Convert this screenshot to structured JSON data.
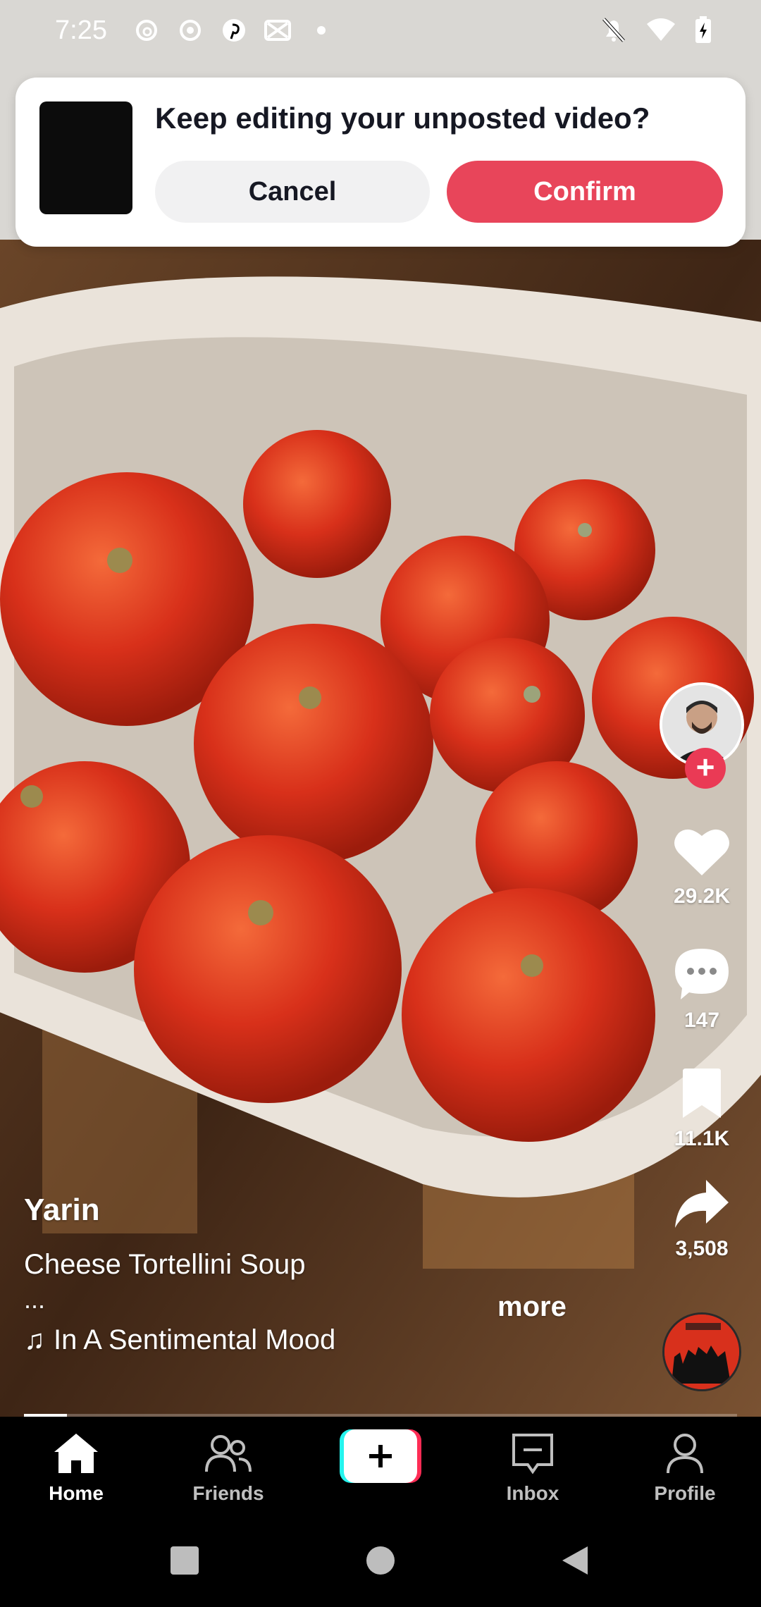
{
  "status_bar": {
    "time": "7:25",
    "left_icons": [
      "threads-icon",
      "record-icon",
      "pinterest-icon",
      "capcut-icon",
      "dot-icon"
    ],
    "right_icons": [
      "bell-off-icon",
      "wifi-icon",
      "battery-charging-icon"
    ]
  },
  "draft_banner": {
    "title": "Keep editing your unposted video?",
    "cancel_label": "Cancel",
    "confirm_label": "Confirm"
  },
  "rail": {
    "likes": "29.2K",
    "comments": "147",
    "bookmarks": "11.1K",
    "shares": "3,508"
  },
  "caption": {
    "author": "Yarin",
    "description": "Cheese Tortellini Soup",
    "ellipsis": "...",
    "more_label": "more",
    "music": "In A Sentimental Mood",
    "music_icon": "♫"
  },
  "progress": {
    "fraction": 0.06
  },
  "bottom_nav": {
    "items": [
      {
        "label": "Home",
        "active": true
      },
      {
        "label": "Friends",
        "active": false
      },
      {
        "label": "",
        "active": false
      },
      {
        "label": "Inbox",
        "active": false
      },
      {
        "label": "Profile",
        "active": false
      }
    ]
  },
  "colors": {
    "accent": "#e8455a",
    "follow": "#ea3a55",
    "create_cyan": "#25f4ee",
    "create_red": "#fe2c55"
  }
}
